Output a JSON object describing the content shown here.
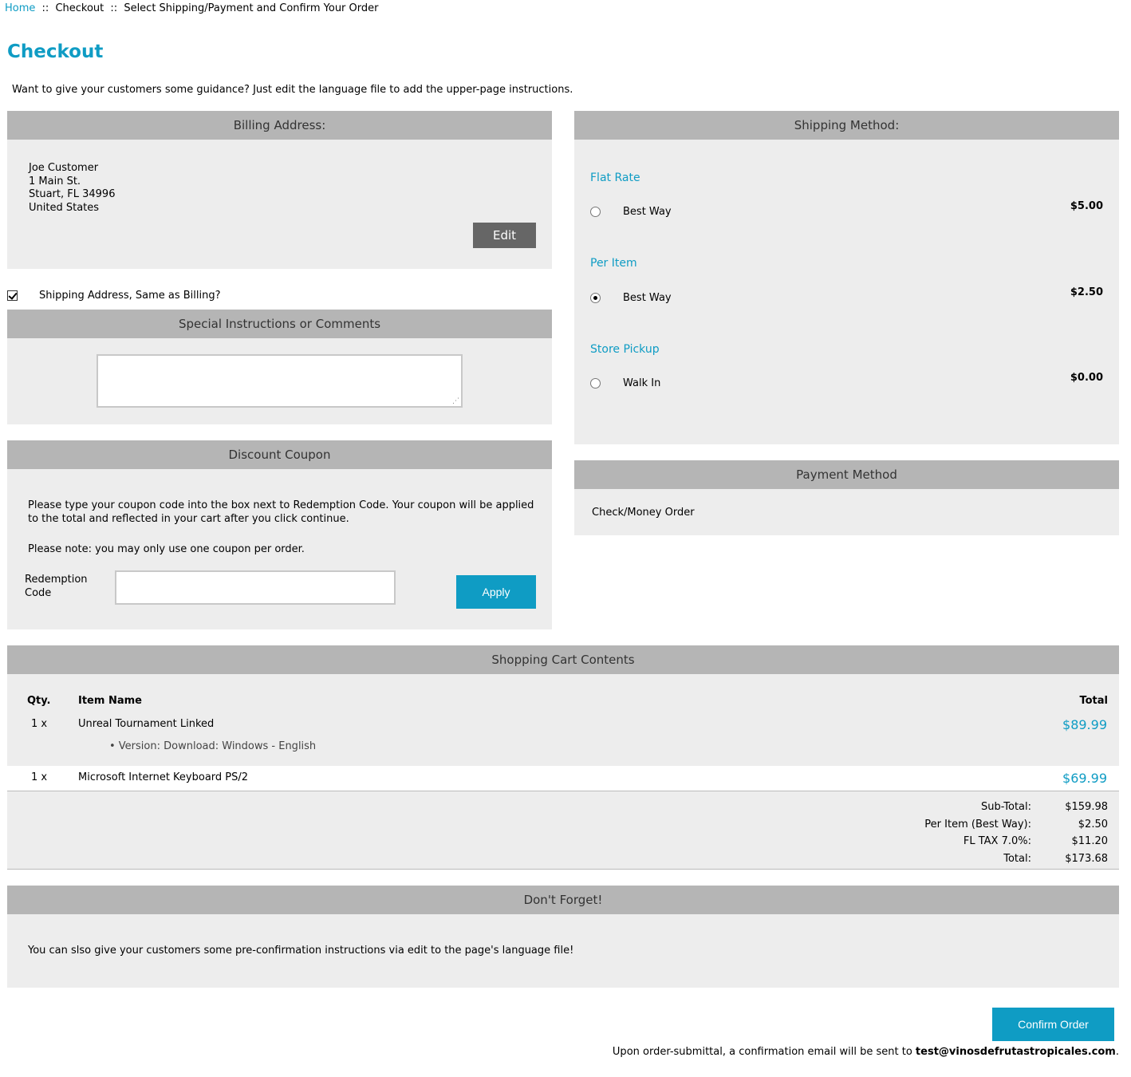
{
  "breadcrumb": {
    "home": "Home",
    "sep": "::",
    "checkout": "Checkout",
    "current": "Select Shipping/Payment and Confirm Your Order"
  },
  "page_title": "Checkout",
  "intro": "Want to give your customers some guidance? Just edit the language file to add the upper-page instructions.",
  "billing": {
    "heading": "Billing Address:",
    "lines": [
      "Joe Customer",
      "1 Main St.",
      "Stuart, FL 34996",
      "United States"
    ],
    "edit_label": "Edit"
  },
  "same_as_billing": {
    "label": "Shipping Address, Same as Billing?",
    "checked": true
  },
  "comments": {
    "heading": "Special Instructions or Comments",
    "value": ""
  },
  "coupon": {
    "heading": "Discount Coupon",
    "text": "Please type your coupon code into the box next to Redemption Code. Your coupon will be applied to the total and reflected in your cart after you click continue.",
    "note": "Please note: you may only use one coupon per order.",
    "label": "Redemption Code",
    "value": "",
    "apply_label": "Apply"
  },
  "shipping": {
    "heading": "Shipping Method:",
    "groups": [
      {
        "title": "Flat Rate",
        "option": "Best Way",
        "price": "$5.00",
        "selected": false
      },
      {
        "title": "Per Item",
        "option": "Best Way",
        "price": "$2.50",
        "selected": true
      },
      {
        "title": "Store Pickup",
        "option": "Walk In",
        "price": "$0.00",
        "selected": false
      }
    ]
  },
  "payment": {
    "heading": "Payment Method",
    "method": "Check/Money Order"
  },
  "cart": {
    "heading": "Shopping Cart Contents",
    "columns": {
      "qty": "Qty.",
      "item": "Item Name",
      "total": "Total"
    },
    "items": [
      {
        "qty": "1 x",
        "name": "Unreal Tournament Linked",
        "attribute": "• Version: Download: Windows - English",
        "price": "$89.99"
      },
      {
        "qty": "1 x",
        "name": "Microsoft Internet Keyboard PS/2",
        "price": "$69.99"
      }
    ],
    "totals": [
      {
        "label": "Sub-Total:",
        "value": "$159.98"
      },
      {
        "label": "Per Item (Best Way):",
        "value": "$2.50"
      },
      {
        "label": "FL TAX 7.0%:",
        "value": "$11.20"
      },
      {
        "label": "Total:",
        "value": "$173.68"
      }
    ]
  },
  "dont_forget": {
    "heading": "Don't Forget!",
    "text": "You can slso give your customers some pre-confirmation instructions via edit to the page's language file!"
  },
  "confirm": {
    "button_label": "Confirm Order",
    "note_prefix": "Upon order-submittal, a confirmation email will be sent to",
    "email": "test@vinosdefrutastropicales.com",
    "note_suffix": "."
  },
  "colors": {
    "accent": "#0f9cc4",
    "panel_bg": "#ededed",
    "panel_header": "#b5b5b5",
    "edit_button": "#666666"
  }
}
